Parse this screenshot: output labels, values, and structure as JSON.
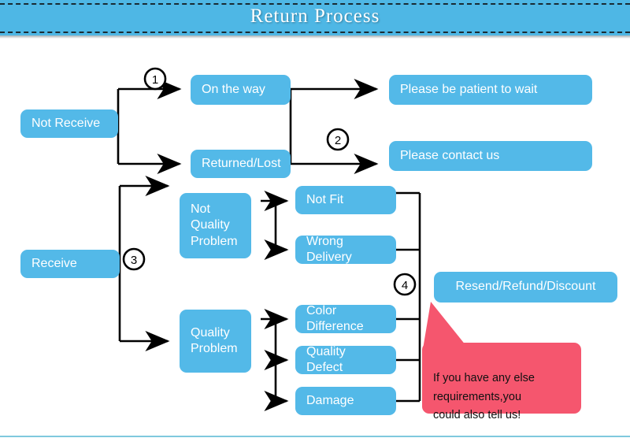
{
  "header": {
    "title": "Return Process",
    "background_color": "#4EB7E5",
    "title_color": "#ffffff",
    "dash_color": "#1a2b33"
  },
  "theme": {
    "node_color": "#53B9E8",
    "node_text_color": "#ffffff",
    "callout_color": "#F5566E",
    "connector_color": "#000000",
    "bottom_rule_color": "#7fc9de"
  },
  "diagram": {
    "type": "flowchart",
    "nodes": [
      {
        "id": "not-receive",
        "label": "Not Receive"
      },
      {
        "id": "on-the-way",
        "label": "On the way"
      },
      {
        "id": "returned-lost",
        "label": "Returned/Lost"
      },
      {
        "id": "be-patient",
        "label": "Please be patient to wait"
      },
      {
        "id": "contact-us",
        "label": "Please contact us"
      },
      {
        "id": "receive",
        "label": "Receive"
      },
      {
        "id": "not-quality-problem",
        "label": "Not\nQuality\nProblem"
      },
      {
        "id": "quality-problem",
        "label": "Quality\nProblem"
      },
      {
        "id": "not-fit",
        "label": "Not Fit"
      },
      {
        "id": "wrong-delivery",
        "label": "Wrong Delivery"
      },
      {
        "id": "color-difference",
        "label": "Color Difference"
      },
      {
        "id": "quality-defect",
        "label": "Quality Defect"
      },
      {
        "id": "damage",
        "label": "Damage"
      },
      {
        "id": "resend-refund-discount",
        "label": "Resend/Refund/Discount"
      }
    ],
    "step_markers": [
      {
        "id": "step-1",
        "label": "1"
      },
      {
        "id": "step-2",
        "label": "2"
      },
      {
        "id": "step-3",
        "label": "3"
      },
      {
        "id": "step-4",
        "label": "4"
      }
    ],
    "edges": [
      {
        "from": "not-receive",
        "to": "on-the-way",
        "marker": "1"
      },
      {
        "from": "not-receive",
        "to": "returned-lost",
        "marker": "1"
      },
      {
        "from": "on-the-way",
        "to": "be-patient",
        "marker": "2"
      },
      {
        "from": "returned-lost",
        "to": "contact-us",
        "marker": "2"
      },
      {
        "from": "receive",
        "to": "not-quality-problem",
        "marker": "3"
      },
      {
        "from": "receive",
        "to": "quality-problem",
        "marker": "3"
      },
      {
        "from": "not-quality-problem",
        "to": "not-fit"
      },
      {
        "from": "not-quality-problem",
        "to": "wrong-delivery"
      },
      {
        "from": "quality-problem",
        "to": "color-difference"
      },
      {
        "from": "quality-problem",
        "to": "quality-defect"
      },
      {
        "from": "quality-problem",
        "to": "damage"
      },
      {
        "from": "not-fit",
        "to": "resend-refund-discount",
        "marker": "4"
      },
      {
        "from": "wrong-delivery",
        "to": "resend-refund-discount",
        "marker": "4"
      },
      {
        "from": "color-difference",
        "to": "resend-refund-discount",
        "marker": "4"
      },
      {
        "from": "quality-defect",
        "to": "resend-refund-discount",
        "marker": "4"
      },
      {
        "from": "damage",
        "to": "resend-refund-discount",
        "marker": "4"
      }
    ]
  },
  "callout": {
    "text": "If you have any else\nrequirements,you\ncould also tell us!"
  }
}
